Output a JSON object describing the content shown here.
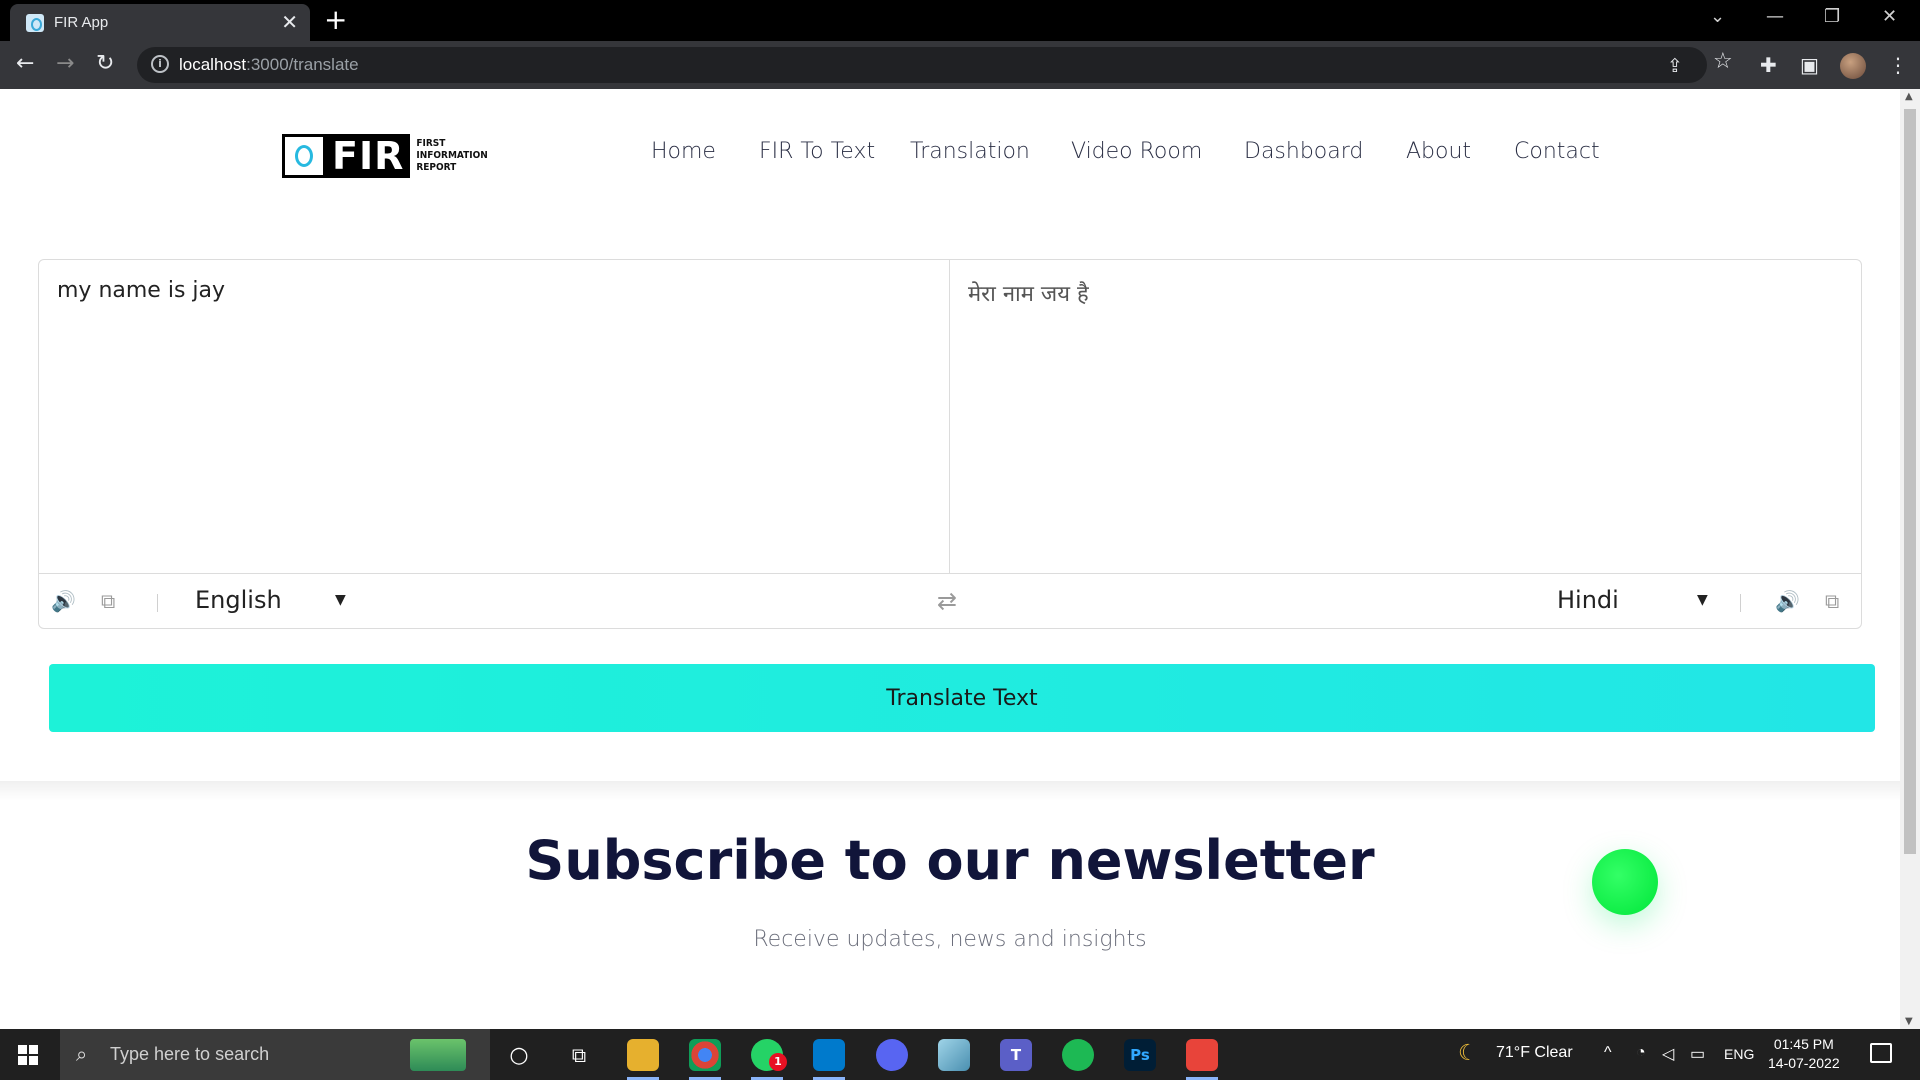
{
  "browser": {
    "tab_title": "FIR App",
    "tab_close": "✕",
    "new_tab": "+",
    "url_host": "localhost",
    "url_path": ":3000/translate",
    "window_controls": [
      "⌄",
      "—",
      "❐",
      "✕"
    ]
  },
  "logo": {
    "text": "FIR",
    "subtitle_lines": [
      "FIRST",
      "INFORMATION",
      "REPORT"
    ]
  },
  "nav": {
    "items": [
      "Home",
      "FIR To Text",
      "Translation",
      "Video Room",
      "Dashboard",
      "About",
      "Contact"
    ]
  },
  "translator": {
    "source_text": "my name is jay",
    "target_text": "मेरा नाम जय है",
    "source_language": "English",
    "target_language": "Hindi",
    "translate_button": "Translate Text"
  },
  "newsletter": {
    "title": "Subscribe to our newsletter",
    "subtitle": "Receive updates, news and insights"
  },
  "taskbar": {
    "search_placeholder": "Type here to search",
    "weather": "71°F  Clear",
    "language": "ENG",
    "time": "01:45 PM",
    "date": "14-07-2022",
    "whatsapp_badge": "1"
  },
  "colors": {
    "accent_button": "#1df2d8",
    "heading": "#11153a",
    "green_dot": "#00e639"
  }
}
